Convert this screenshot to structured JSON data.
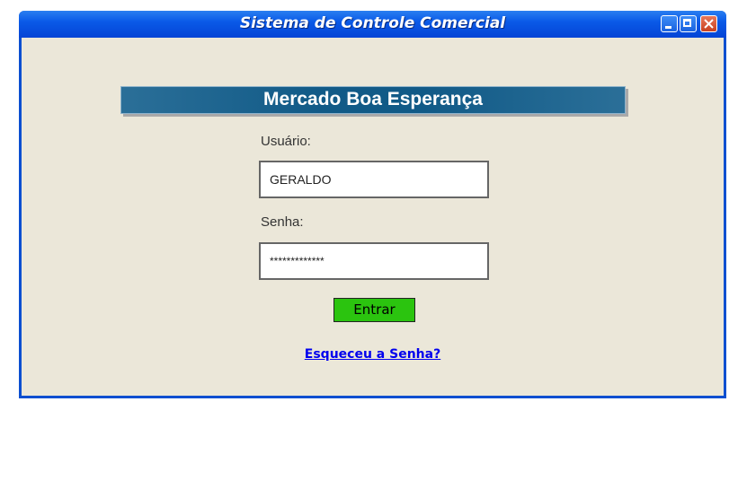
{
  "window": {
    "title": "Sistema de Controle Comercial",
    "accent_color": "#0b4fd0",
    "controls": [
      "minimize-icon",
      "maximize-icon",
      "close-icon"
    ]
  },
  "banner": {
    "title": "Mercado Boa Esperança"
  },
  "form": {
    "user_label": "Usuário:",
    "user_value": "GERALDO",
    "password_label": "Senha:",
    "password_value": "*************",
    "submit_label": "Entrar",
    "submit_color": "#2bc40f",
    "forgot_link": "Esqueceu a Senha?"
  }
}
